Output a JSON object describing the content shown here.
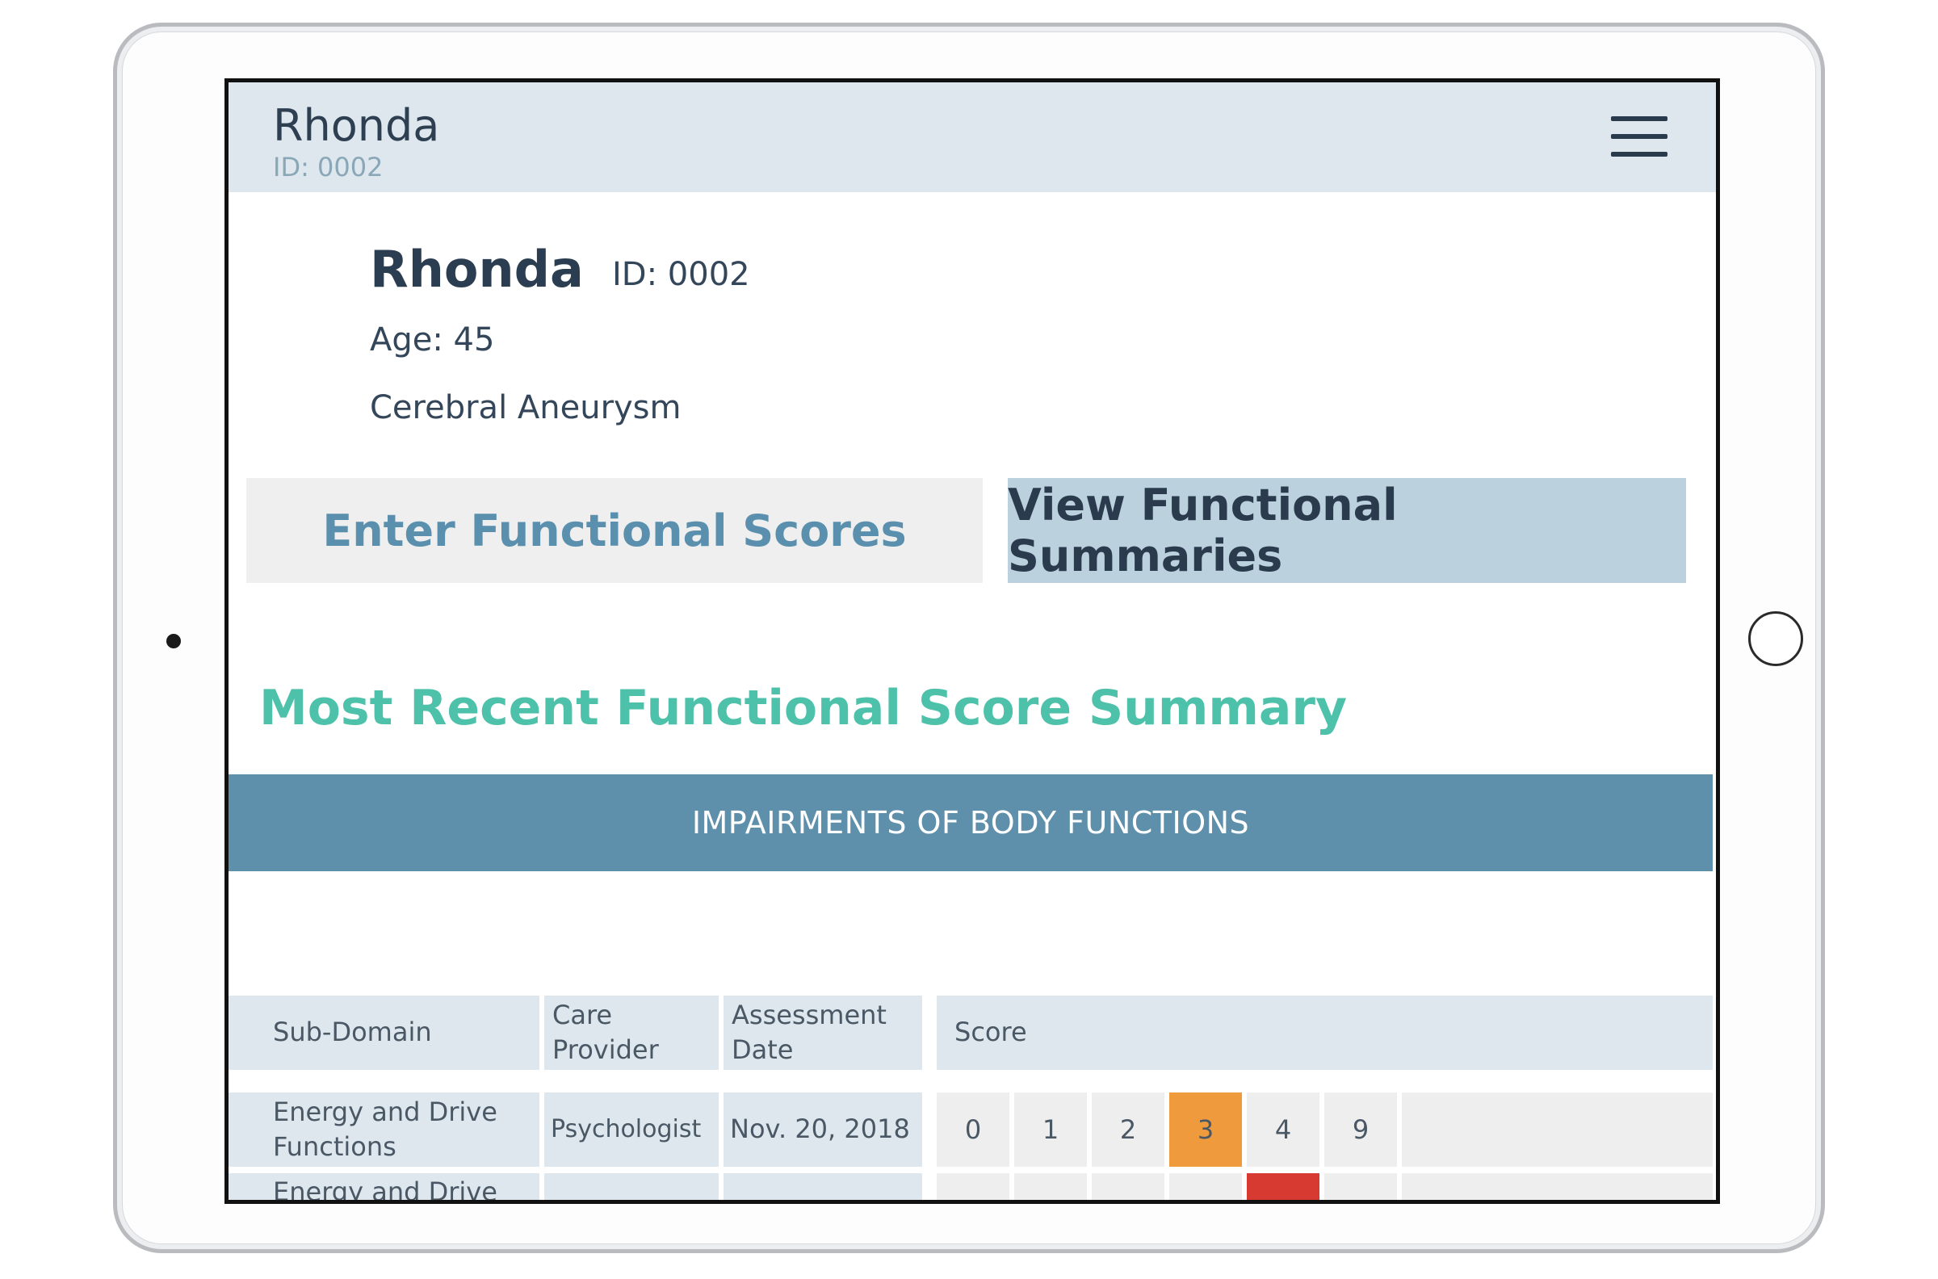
{
  "header": {
    "name": "Rhonda",
    "id_label": "ID: 0002"
  },
  "profile": {
    "name": "Rhonda",
    "id_label": "ID: 0002",
    "age_label": "Age: 45",
    "diagnosis": "Cerebral Aneurysm"
  },
  "actions": {
    "enter_label": "Enter Functional Scores",
    "view_label": "View Functional Summaries"
  },
  "section": {
    "title": "Most Recent Functional Score Summary",
    "banner": "IMPAIRMENTS OF BODY FUNCTIONS"
  },
  "table": {
    "headers": {
      "sub_domain": "Sub-Domain",
      "care_provider_line1": "Care",
      "care_provider_line2": "Provider",
      "assessment_line1": "Assessment",
      "assessment_line2": "Date",
      "score": "Score"
    },
    "rows": [
      {
        "sub_domain_line1": "Energy and Drive",
        "sub_domain_line2": "Functions",
        "care_provider": "Psychologist",
        "date": "Nov. 20, 2018",
        "scores": [
          "0",
          "1",
          "2",
          "3",
          "4",
          "9"
        ],
        "selected_score": "3"
      },
      {
        "sub_domain_line1": "Energy and Drive",
        "care_provider": "",
        "date": "",
        "selected_score": "4"
      }
    ]
  },
  "colors": {
    "accent_teal": "#4dc1a9",
    "banner_blue": "#5e8fab",
    "selected_orange": "#ef9a3c",
    "selected_red": "#d63a30",
    "header_bg": "#dde7ed"
  }
}
